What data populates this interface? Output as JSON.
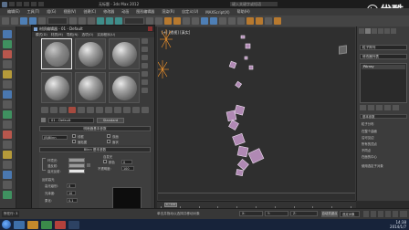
{
  "window": {
    "title": "无标题 - 3ds Max 2012",
    "search_placeholder": "键入关键字或短语"
  },
  "watermark": {
    "text": "优酷"
  },
  "menubar": {
    "items": [
      "编辑(E)",
      "工具(T)",
      "组(G)",
      "视图(V)",
      "创建(C)",
      "修改器",
      "动画",
      "图形编辑器",
      "渲染(R)",
      "自定义(U)",
      "MAXScript(X)",
      "帮助(H)"
    ]
  },
  "toolbar": {
    "selection_filter": "全部"
  },
  "viewport": {
    "label": "[+] [透视] [真实]"
  },
  "material_editor": {
    "title": "材质编辑器 - 01 - Default",
    "menu": [
      "模式(D)",
      "材质(M)",
      "导航(N)",
      "选项(O)",
      "实用程序(U)"
    ],
    "material_name": "01 - Default",
    "material_type": "Standard",
    "rollout_shader": "明暗器基本参数",
    "shader_type": "(B)Blinn",
    "options": [
      "线框",
      "双面",
      "面贴图",
      "面状"
    ],
    "rollout_blinn": "Blinn 基本参数",
    "self_illum_group": "自发光",
    "ambient_label": "环境光:",
    "diffuse_label": "漫反射:",
    "specular_label": "高光反射:",
    "color_label": "颜色",
    "color_value": "0",
    "opacity_label": "不透明度:",
    "opacity_value": "100",
    "spec_group": "反射高光",
    "spec_level_label": "高光级别:",
    "spec_level_value": "0",
    "gloss_label": "光泽度:",
    "gloss_value": "10",
    "soften_label": "柔化:",
    "soften_value": "0.1"
  },
  "command_panel": {
    "object_name": "粒子阵列",
    "modifier_list_label": "修改器列表",
    "stack_item": "PArray",
    "section_basic": "基本参数",
    "section_emitter": "粒子分布",
    "opts": [
      "在整个曲面",
      "沿可见边",
      "所有的顶点",
      "不同点",
      "在面的中心"
    ],
    "use_selected": "使用选定子对象"
  },
  "timeline": {
    "slider_text": "0 / 100",
    "ticks": [
      "0",
      "10",
      "20",
      "30",
      "40",
      "50",
      "60",
      "70",
      "80",
      "90",
      "100"
    ]
  },
  "statusbar": {
    "left_text": "所在行: 3",
    "hint": "单击并拖动以选择并移动对象",
    "x_label": "X:",
    "y_label": "Y:",
    "z_label": "Z:",
    "autokey": "自动关键点",
    "setkey_mode": "选定对象"
  },
  "taskbar": {
    "time": "14:38",
    "date": "2014/1/7"
  }
}
